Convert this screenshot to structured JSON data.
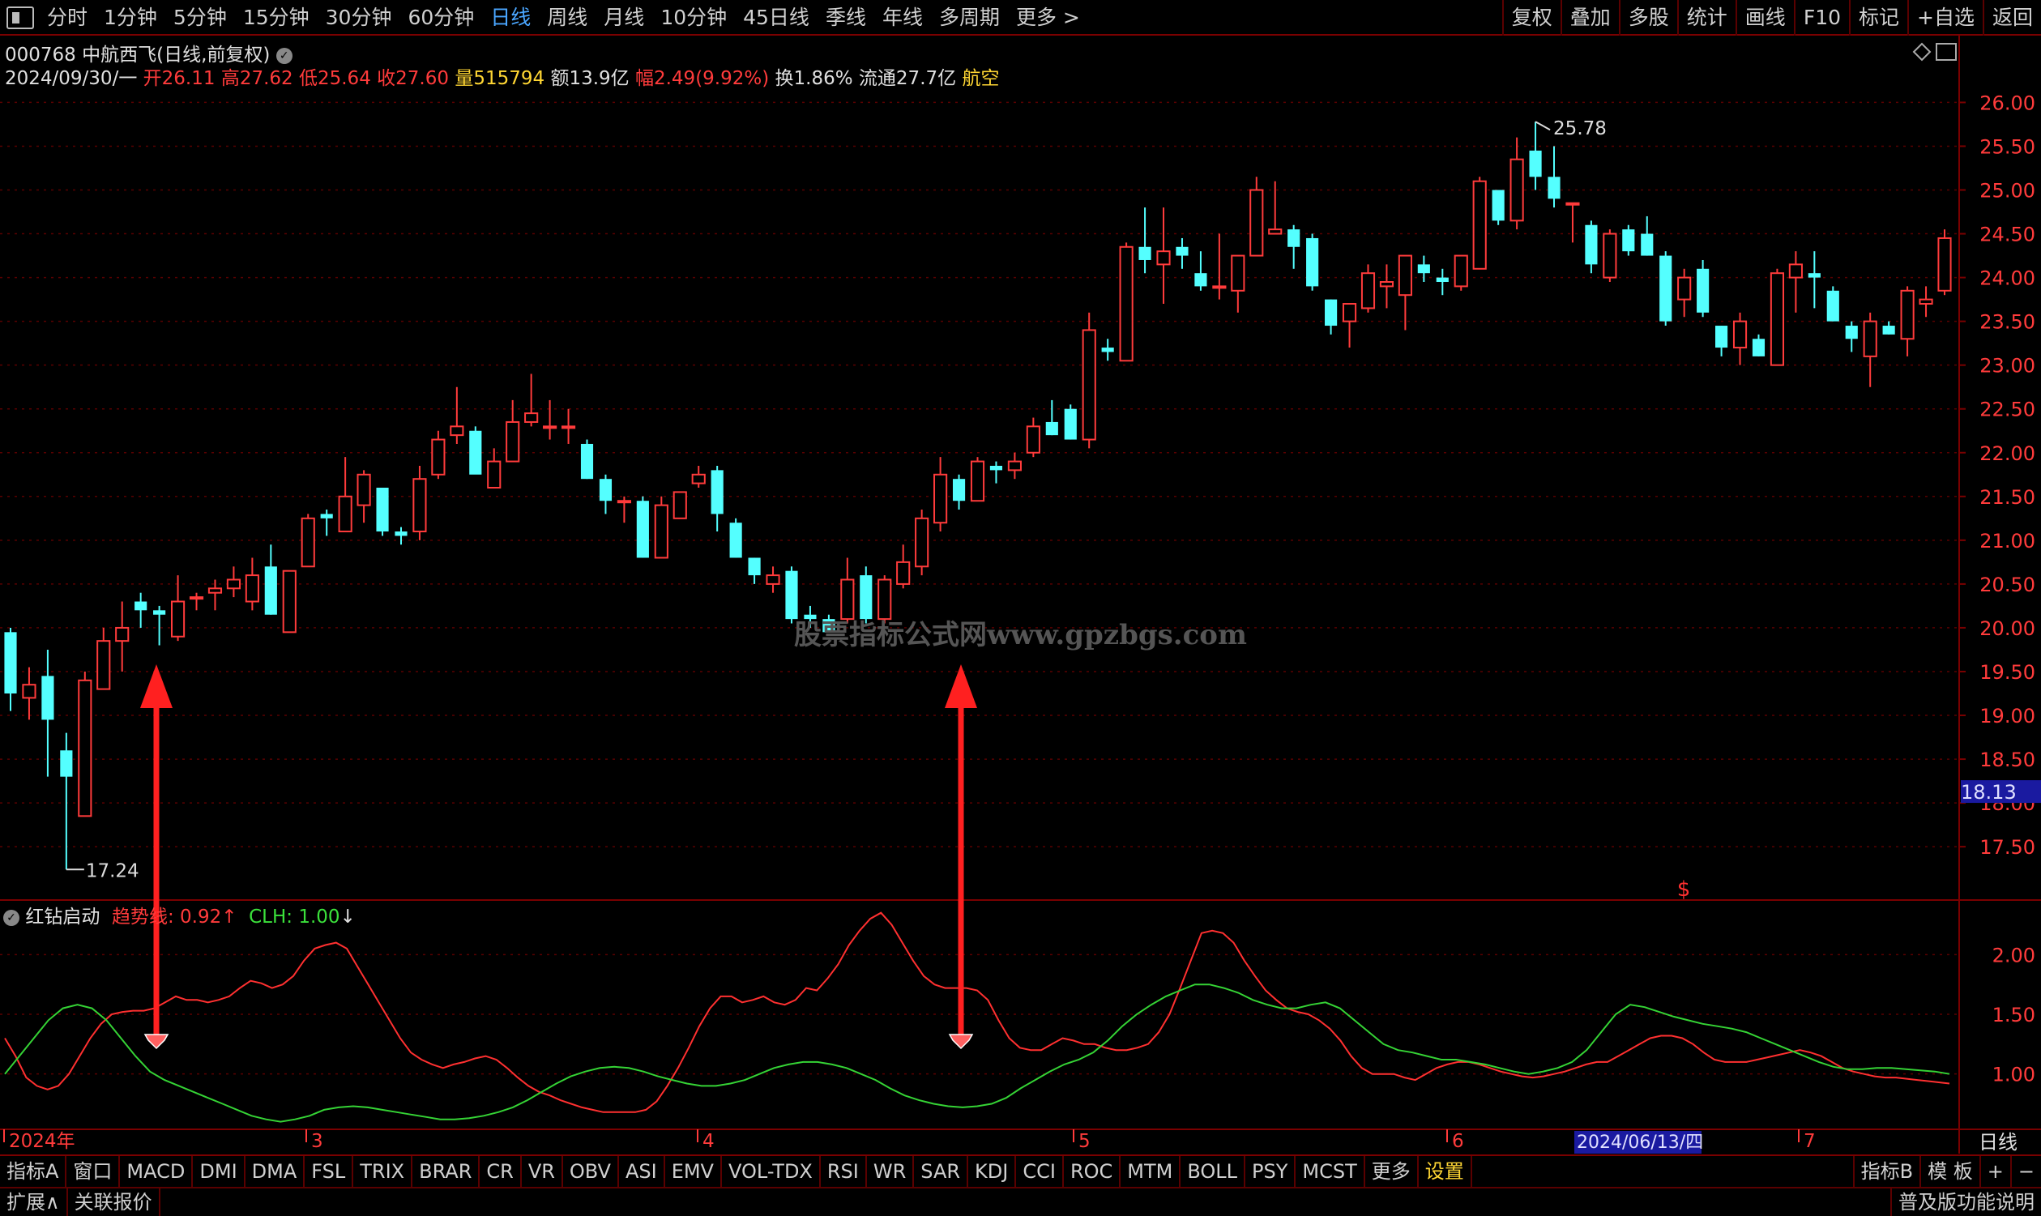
{
  "toolbar": {
    "periods": [
      "分时",
      "1分钟",
      "5分钟",
      "15分钟",
      "30分钟",
      "60分钟",
      "日线",
      "周线",
      "月线",
      "10分钟",
      "45日线",
      "季线",
      "年线",
      "多周期",
      "更多 >"
    ],
    "active_period": "日线",
    "right": [
      "复权",
      "叠加",
      "多股",
      "统计",
      "画线",
      "F10",
      "标记",
      "+自选",
      "返回"
    ]
  },
  "stock": {
    "title": "000768 中航西飞(日线,前复权)",
    "date": "2024/09/30/一",
    "open_label": "开",
    "open": "26.11",
    "high_label": "高",
    "high": "27.62",
    "low_label": "低",
    "low": "25.64",
    "close_label": "收",
    "close": "27.60",
    "vol_label": "量",
    "vol": "515794",
    "amount_label": "额",
    "amount": "13.9亿",
    "chg_label": "幅",
    "chg": "2.49(9.92%)",
    "turnover_label": "换",
    "turnover": "1.86%",
    "float_label": "流通",
    "float_cap": "27.7亿",
    "sector": "航空"
  },
  "watermark": "股票指标公式网www.gpzbgs.com",
  "price_axis": {
    "ticks": [
      "26.00",
      "25.50",
      "25.00",
      "24.50",
      "24.00",
      "23.50",
      "23.00",
      "22.50",
      "22.00",
      "21.50",
      "21.00",
      "20.50",
      "20.00",
      "19.50",
      "19.00",
      "18.50",
      "18.00",
      "17.50"
    ],
    "current_label": "18.13",
    "high_marker": "25.78",
    "low_marker": "17.24"
  },
  "indicator": {
    "name": "红钻启动",
    "line1_label": "趋势线:",
    "line1_value": "0.92",
    "line2_label": "CLH:",
    "line2_value": "1.00",
    "ticks": [
      "2.00",
      "1.50",
      "1.00"
    ]
  },
  "date_axis": {
    "labels": [
      "2024年",
      "3",
      "4",
      "5",
      "6",
      "7"
    ],
    "cursor_date": "2024/06/13/四",
    "period": "日线"
  },
  "indicator_tabs": [
    "指标A",
    "窗口",
    "MACD",
    "DMI",
    "DMA",
    "FSL",
    "TRIX",
    "BRAR",
    "CR",
    "VR",
    "OBV",
    "ASI",
    "EMV",
    "VOL-TDX",
    "RSI",
    "WR",
    "SAR",
    "KDJ",
    "CCI",
    "ROC",
    "MTM",
    "BOLL",
    "PSY",
    "MCST",
    "更多",
    "设置"
  ],
  "indicator_tabs_right": [
    "指标B",
    "模 板",
    "+",
    "−"
  ],
  "footer_left": [
    "扩展∧",
    "关联报价"
  ],
  "footer_right": "普及版功能说明",
  "colors": {
    "up": "#ff3b3b",
    "down": "#54ffff",
    "trend": "#ff3030",
    "clh": "#35d335",
    "border": "#7a0000",
    "grid": "#5a0000"
  },
  "chart_data": {
    "type": "candlestick",
    "ylim": [
      16.9,
      26.3
    ],
    "candles": [
      {
        "o": 19.95,
        "h": 20.0,
        "l": 19.05,
        "c": 19.25
      },
      {
        "o": 19.2,
        "h": 19.55,
        "l": 18.95,
        "c": 19.35
      },
      {
        "o": 19.45,
        "h": 19.75,
        "l": 18.3,
        "c": 18.95
      },
      {
        "o": 18.6,
        "h": 18.8,
        "l": 17.24,
        "c": 18.3
      },
      {
        "o": 17.85,
        "h": 19.5,
        "l": 17.85,
        "c": 19.4
      },
      {
        "o": 19.3,
        "h": 20.0,
        "l": 19.3,
        "c": 19.85
      },
      {
        "o": 19.85,
        "h": 20.3,
        "l": 19.5,
        "c": 20.0
      },
      {
        "o": 20.3,
        "h": 20.4,
        "l": 20.0,
        "c": 20.2
      },
      {
        "o": 20.2,
        "h": 20.25,
        "l": 19.8,
        "c": 20.15
      },
      {
        "o": 19.9,
        "h": 20.6,
        "l": 19.85,
        "c": 20.3
      },
      {
        "o": 20.35,
        "h": 20.4,
        "l": 20.2,
        "c": 20.35
      },
      {
        "o": 20.4,
        "h": 20.55,
        "l": 20.2,
        "c": 20.45
      },
      {
        "o": 20.45,
        "h": 20.7,
        "l": 20.35,
        "c": 20.55
      },
      {
        "o": 20.3,
        "h": 20.8,
        "l": 20.2,
        "c": 20.6
      },
      {
        "o": 20.7,
        "h": 20.95,
        "l": 20.15,
        "c": 20.15
      },
      {
        "o": 19.95,
        "h": 20.65,
        "l": 19.95,
        "c": 20.65
      },
      {
        "o": 20.7,
        "h": 21.3,
        "l": 20.7,
        "c": 21.25
      },
      {
        "o": 21.3,
        "h": 21.35,
        "l": 21.05,
        "c": 21.25
      },
      {
        "o": 21.1,
        "h": 21.95,
        "l": 21.1,
        "c": 21.5
      },
      {
        "o": 21.4,
        "h": 21.8,
        "l": 21.2,
        "c": 21.75
      },
      {
        "o": 21.6,
        "h": 21.6,
        "l": 21.05,
        "c": 21.1
      },
      {
        "o": 21.1,
        "h": 21.15,
        "l": 20.95,
        "c": 21.05
      },
      {
        "o": 21.1,
        "h": 21.85,
        "l": 21.0,
        "c": 21.7
      },
      {
        "o": 21.75,
        "h": 22.25,
        "l": 21.7,
        "c": 22.15
      },
      {
        "o": 22.2,
        "h": 22.75,
        "l": 22.1,
        "c": 22.3
      },
      {
        "o": 22.25,
        "h": 22.3,
        "l": 21.85,
        "c": 21.75
      },
      {
        "o": 21.6,
        "h": 22.05,
        "l": 21.6,
        "c": 21.9
      },
      {
        "o": 21.9,
        "h": 22.6,
        "l": 21.9,
        "c": 22.35
      },
      {
        "o": 22.35,
        "h": 22.9,
        "l": 22.3,
        "c": 22.45
      },
      {
        "o": 22.3,
        "h": 22.6,
        "l": 22.15,
        "c": 22.3
      },
      {
        "o": 22.3,
        "h": 22.5,
        "l": 22.1,
        "c": 22.3
      },
      {
        "o": 22.1,
        "h": 22.15,
        "l": 21.7,
        "c": 21.7
      },
      {
        "o": 21.7,
        "h": 21.75,
        "l": 21.3,
        "c": 21.45
      },
      {
        "o": 21.45,
        "h": 21.5,
        "l": 21.2,
        "c": 21.45
      },
      {
        "o": 21.45,
        "h": 21.5,
        "l": 20.8,
        "c": 20.8
      },
      {
        "o": 20.8,
        "h": 21.5,
        "l": 20.8,
        "c": 21.4
      },
      {
        "o": 21.25,
        "h": 21.55,
        "l": 21.25,
        "c": 21.55
      },
      {
        "o": 21.65,
        "h": 21.85,
        "l": 21.6,
        "c": 21.75
      },
      {
        "o": 21.8,
        "h": 21.85,
        "l": 21.1,
        "c": 21.3
      },
      {
        "o": 21.2,
        "h": 21.25,
        "l": 20.8,
        "c": 20.8
      },
      {
        "o": 20.8,
        "h": 20.8,
        "l": 20.5,
        "c": 20.6
      },
      {
        "o": 20.5,
        "h": 20.7,
        "l": 20.4,
        "c": 20.6
      },
      {
        "o": 20.65,
        "h": 20.7,
        "l": 20.05,
        "c": 20.1
      },
      {
        "o": 20.15,
        "h": 20.25,
        "l": 20.0,
        "c": 20.1
      },
      {
        "o": 20.1,
        "h": 20.15,
        "l": 19.95,
        "c": 19.95
      },
      {
        "o": 20.1,
        "h": 20.8,
        "l": 20.05,
        "c": 20.55
      },
      {
        "o": 20.6,
        "h": 20.7,
        "l": 20.05,
        "c": 20.1
      },
      {
        "o": 20.1,
        "h": 20.6,
        "l": 20.05,
        "c": 20.55
      },
      {
        "o": 20.5,
        "h": 20.95,
        "l": 20.45,
        "c": 20.75
      },
      {
        "o": 20.7,
        "h": 21.35,
        "l": 20.6,
        "c": 21.25
      },
      {
        "o": 21.2,
        "h": 21.95,
        "l": 21.1,
        "c": 21.75
      },
      {
        "o": 21.7,
        "h": 21.75,
        "l": 21.35,
        "c": 21.45
      },
      {
        "o": 21.45,
        "h": 21.95,
        "l": 21.45,
        "c": 21.9
      },
      {
        "o": 21.85,
        "h": 21.9,
        "l": 21.65,
        "c": 21.8
      },
      {
        "o": 21.8,
        "h": 22.0,
        "l": 21.7,
        "c": 21.9
      },
      {
        "o": 22.0,
        "h": 22.4,
        "l": 21.95,
        "c": 22.3
      },
      {
        "o": 22.35,
        "h": 22.6,
        "l": 22.2,
        "c": 22.2
      },
      {
        "o": 22.5,
        "h": 22.55,
        "l": 22.15,
        "c": 22.15
      },
      {
        "o": 22.15,
        "h": 23.6,
        "l": 22.05,
        "c": 23.4
      },
      {
        "o": 23.2,
        "h": 23.3,
        "l": 23.05,
        "c": 23.15
      },
      {
        "o": 23.05,
        "h": 24.4,
        "l": 23.05,
        "c": 24.35
      },
      {
        "o": 24.35,
        "h": 24.8,
        "l": 24.05,
        "c": 24.2
      },
      {
        "o": 24.15,
        "h": 24.8,
        "l": 23.7,
        "c": 24.3
      },
      {
        "o": 24.35,
        "h": 24.45,
        "l": 24.1,
        "c": 24.25
      },
      {
        "o": 24.05,
        "h": 24.3,
        "l": 23.85,
        "c": 23.9
      },
      {
        "o": 23.9,
        "h": 24.5,
        "l": 23.75,
        "c": 23.9
      },
      {
        "o": 23.85,
        "h": 24.15,
        "l": 23.6,
        "c": 24.25
      },
      {
        "o": 24.25,
        "h": 25.15,
        "l": 24.25,
        "c": 25.0
      },
      {
        "o": 24.5,
        "h": 25.1,
        "l": 24.5,
        "c": 24.55
      },
      {
        "o": 24.55,
        "h": 24.6,
        "l": 24.1,
        "c": 24.35
      },
      {
        "o": 24.45,
        "h": 24.5,
        "l": 23.85,
        "c": 23.9
      },
      {
        "o": 23.75,
        "h": 23.75,
        "l": 23.35,
        "c": 23.45
      },
      {
        "o": 23.5,
        "h": 23.7,
        "l": 23.2,
        "c": 23.7
      },
      {
        "o": 23.65,
        "h": 24.15,
        "l": 23.6,
        "c": 24.05
      },
      {
        "o": 23.9,
        "h": 24.15,
        "l": 23.65,
        "c": 23.95
      },
      {
        "o": 23.8,
        "h": 24.25,
        "l": 23.4,
        "c": 24.25
      },
      {
        "o": 24.15,
        "h": 24.25,
        "l": 23.95,
        "c": 24.05
      },
      {
        "o": 24.0,
        "h": 24.1,
        "l": 23.8,
        "c": 23.95
      },
      {
        "o": 23.9,
        "h": 24.25,
        "l": 23.85,
        "c": 24.25
      },
      {
        "o": 24.1,
        "h": 25.15,
        "l": 24.1,
        "c": 25.1
      },
      {
        "o": 25.0,
        "h": 25.0,
        "l": 24.6,
        "c": 24.65
      },
      {
        "o": 24.65,
        "h": 25.6,
        "l": 24.55,
        "c": 25.35
      },
      {
        "o": 25.45,
        "h": 25.78,
        "l": 25.0,
        "c": 25.15
      },
      {
        "o": 25.15,
        "h": 25.5,
        "l": 24.8,
        "c": 24.9
      },
      {
        "o": 24.85,
        "h": 24.85,
        "l": 24.4,
        "c": 24.85
      },
      {
        "o": 24.6,
        "h": 24.65,
        "l": 24.05,
        "c": 24.15
      },
      {
        "o": 24.0,
        "h": 24.55,
        "l": 23.95,
        "c": 24.5
      },
      {
        "o": 24.55,
        "h": 24.6,
        "l": 24.25,
        "c": 24.3
      },
      {
        "o": 24.5,
        "h": 24.7,
        "l": 24.25,
        "c": 24.25
      },
      {
        "o": 24.25,
        "h": 24.3,
        "l": 23.45,
        "c": 23.5
      },
      {
        "o": 23.75,
        "h": 24.1,
        "l": 23.55,
        "c": 24.0
      },
      {
        "o": 24.1,
        "h": 24.2,
        "l": 23.55,
        "c": 23.6
      },
      {
        "o": 23.45,
        "h": 23.45,
        "l": 23.1,
        "c": 23.2
      },
      {
        "o": 23.2,
        "h": 23.6,
        "l": 23.0,
        "c": 23.5
      },
      {
        "o": 23.3,
        "h": 23.35,
        "l": 23.1,
        "c": 23.1
      },
      {
        "o": 23.0,
        "h": 24.1,
        "l": 23.0,
        "c": 24.05
      },
      {
        "o": 24.0,
        "h": 24.3,
        "l": 23.6,
        "c": 24.15
      },
      {
        "o": 24.05,
        "h": 24.3,
        "l": 23.65,
        "c": 24.0
      },
      {
        "o": 23.85,
        "h": 23.9,
        "l": 23.5,
        "c": 23.5
      },
      {
        "o": 23.45,
        "h": 23.5,
        "l": 23.15,
        "c": 23.3
      },
      {
        "o": 23.1,
        "h": 23.6,
        "l": 22.75,
        "c": 23.5
      },
      {
        "o": 23.45,
        "h": 23.5,
        "l": 23.35,
        "c": 23.35
      },
      {
        "o": 23.3,
        "h": 23.9,
        "l": 23.1,
        "c": 23.85
      },
      {
        "o": 23.7,
        "h": 23.9,
        "l": 23.55,
        "c": 23.75
      },
      {
        "o": 23.85,
        "h": 24.55,
        "l": 23.8,
        "c": 24.45
      }
    ],
    "indicator_ylim": [
      0.55,
      2.45
    ],
    "trend_line": [
      1.3,
      1.15,
      0.97,
      0.9,
      0.87,
      0.9,
      1.0,
      1.15,
      1.3,
      1.42,
      1.5,
      1.52,
      1.53,
      1.53,
      1.55,
      1.6,
      1.65,
      1.62,
      1.62,
      1.6,
      1.62,
      1.65,
      1.72,
      1.78,
      1.76,
      1.72,
      1.75,
      1.82,
      1.95,
      2.05,
      2.08,
      2.1,
      2.05,
      1.9,
      1.75,
      1.6,
      1.45,
      1.3,
      1.18,
      1.12,
      1.08,
      1.05,
      1.08,
      1.1,
      1.13,
      1.15,
      1.12,
      1.05,
      0.97,
      0.9,
      0.85,
      0.82,
      0.78,
      0.75,
      0.72,
      0.7,
      0.68,
      0.68,
      0.68,
      0.68,
      0.7,
      0.77,
      0.9,
      1.05,
      1.22,
      1.4,
      1.55,
      1.65,
      1.65,
      1.6,
      1.62,
      1.65,
      1.6,
      1.58,
      1.62,
      1.72,
      1.7,
      1.8,
      1.92,
      2.08,
      2.2,
      2.3,
      2.35,
      2.25,
      2.1,
      1.95,
      1.82,
      1.75,
      1.72,
      1.72,
      1.72,
      1.7,
      1.62,
      1.45,
      1.3,
      1.22,
      1.2,
      1.2,
      1.25,
      1.3,
      1.28,
      1.25,
      1.25,
      1.22,
      1.2,
      1.2,
      1.22,
      1.25,
      1.35,
      1.5,
      1.72,
      1.95,
      2.18,
      2.2,
      2.18,
      2.1,
      1.95,
      1.82,
      1.7,
      1.62,
      1.55,
      1.52,
      1.5,
      1.45,
      1.38,
      1.28,
      1.15,
      1.05,
      1.0,
      1.0,
      1.0,
      0.97,
      0.95,
      1.0,
      1.05,
      1.08,
      1.1,
      1.1,
      1.08,
      1.05,
      1.02,
      1.0,
      0.98,
      0.97,
      0.98,
      1.0,
      1.02,
      1.05,
      1.08,
      1.1,
      1.1,
      1.15,
      1.2,
      1.25,
      1.3,
      1.32,
      1.32,
      1.3,
      1.25,
      1.18,
      1.12,
      1.1,
      1.1,
      1.1,
      1.12,
      1.14,
      1.16,
      1.18,
      1.2,
      1.18,
      1.15,
      1.1,
      1.05,
      1.02,
      1.0,
      0.98,
      0.97,
      0.97,
      0.96,
      0.95,
      0.94,
      0.93,
      0.92
    ],
    "clh_line": [
      1.0,
      1.15,
      1.3,
      1.45,
      1.55,
      1.58,
      1.55,
      1.45,
      1.3,
      1.15,
      1.02,
      0.95,
      0.9,
      0.85,
      0.8,
      0.75,
      0.7,
      0.65,
      0.62,
      0.6,
      0.62,
      0.65,
      0.7,
      0.72,
      0.73,
      0.72,
      0.7,
      0.68,
      0.66,
      0.64,
      0.62,
      0.62,
      0.63,
      0.65,
      0.68,
      0.72,
      0.78,
      0.85,
      0.92,
      0.98,
      1.02,
      1.05,
      1.06,
      1.05,
      1.02,
      0.98,
      0.95,
      0.92,
      0.9,
      0.9,
      0.92,
      0.95,
      1.0,
      1.05,
      1.08,
      1.1,
      1.1,
      1.08,
      1.05,
      1.0,
      0.95,
      0.88,
      0.82,
      0.78,
      0.75,
      0.73,
      0.72,
      0.73,
      0.75,
      0.8,
      0.88,
      0.95,
      1.02,
      1.08,
      1.12,
      1.18,
      1.28,
      1.4,
      1.5,
      1.58,
      1.65,
      1.7,
      1.75,
      1.75,
      1.72,
      1.68,
      1.62,
      1.58,
      1.55,
      1.55,
      1.58,
      1.6,
      1.55,
      1.45,
      1.35,
      1.25,
      1.2,
      1.18,
      1.15,
      1.12,
      1.12,
      1.1,
      1.08,
      1.05,
      1.02,
      1.0,
      1.02,
      1.05,
      1.1,
      1.2,
      1.35,
      1.5,
      1.58,
      1.56,
      1.52,
      1.48,
      1.45,
      1.42,
      1.4,
      1.38,
      1.35,
      1.3,
      1.25,
      1.2,
      1.15,
      1.1,
      1.06,
      1.04,
      1.04,
      1.05,
      1.05,
      1.04,
      1.03,
      1.02,
      1.0
    ]
  }
}
